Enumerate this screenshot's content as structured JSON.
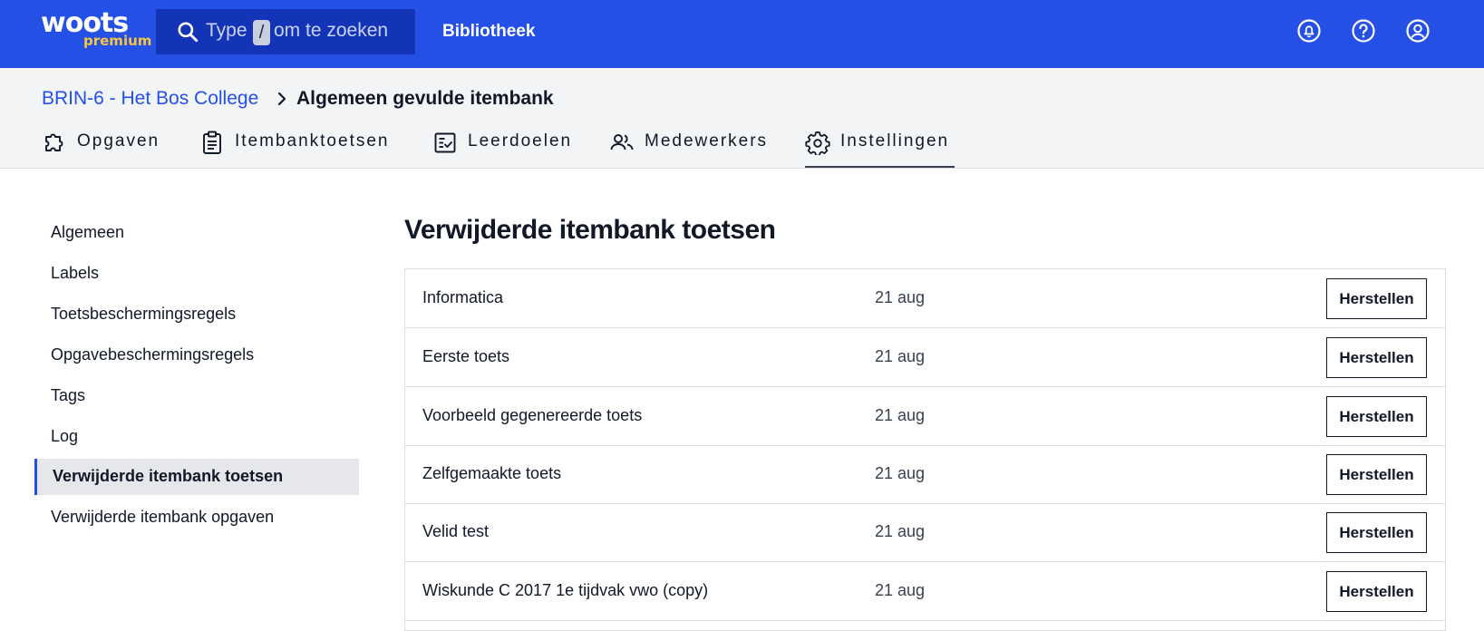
{
  "topbar": {
    "logo_word": "woots",
    "logo_sub": "premium",
    "search_prefix": "Type",
    "search_key": "/",
    "search_suffix": "om te zoeken",
    "library_link": "Bibliotheek",
    "icons": [
      "notification-icon",
      "help-icon",
      "account-icon"
    ]
  },
  "breadcrumb": {
    "parent": "BRIN-6 - Het Bos College",
    "current": "Algemeen gevulde itembank"
  },
  "tabs": [
    {
      "label": "Opgaven",
      "icon": "puzzle-icon"
    },
    {
      "label": "Itembanktoetsen",
      "icon": "clipboard-icon"
    },
    {
      "label": "Leerdoelen",
      "icon": "checklist-icon"
    },
    {
      "label": "Medewerkers",
      "icon": "people-icon"
    },
    {
      "label": "Instellingen",
      "icon": "gear-icon",
      "active": true
    }
  ],
  "sidebar": {
    "items": [
      "Algemeen",
      "Labels",
      "Toetsbeschermingsregels",
      "Opgavebeschermingsregels",
      "Tags",
      "Log",
      "Verwijderde itembank toetsen",
      "Verwijderde itembank opgaven"
    ],
    "active": "Verwijderde itembank toetsen"
  },
  "main": {
    "title": "Verwijderde itembank toetsen",
    "restore_label": "Herstellen",
    "rows": [
      {
        "name": "Informatica",
        "date": "21 aug"
      },
      {
        "name": "Eerste toets",
        "date": "21 aug"
      },
      {
        "name": "Voorbeeld gegenereerde toets",
        "date": "21 aug"
      },
      {
        "name": "Zelfgemaakte toets",
        "date": "21 aug"
      },
      {
        "name": "Velid test",
        "date": "21 aug"
      },
      {
        "name": "Wiskunde C 2017 1e tijdvak vwo (copy)",
        "date": "21 aug"
      }
    ]
  },
  "colors": {
    "brand": "#2450e6",
    "search_bg": "#1434b8",
    "logo_accent": "#f5c542"
  }
}
